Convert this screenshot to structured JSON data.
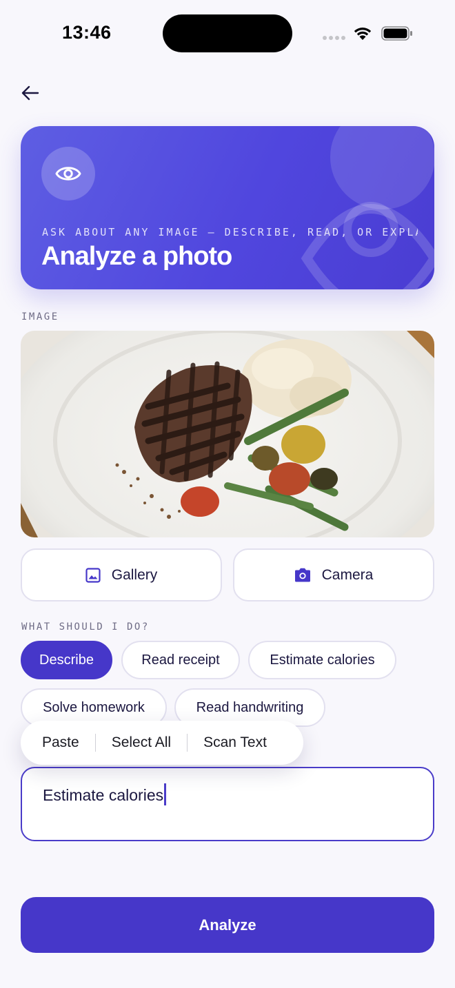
{
  "status_bar": {
    "time": "13:46"
  },
  "hero": {
    "subtitle": "ASK ABOUT ANY IMAGE — DESCRIBE, READ, OR EXPLA…",
    "title": "Analyze a photo",
    "icon": "eye-icon"
  },
  "image_section": {
    "label": "IMAGE"
  },
  "source_buttons": {
    "gallery": {
      "label": "Gallery",
      "icon": "image-icon"
    },
    "camera": {
      "label": "Camera",
      "icon": "camera-icon"
    }
  },
  "actions": {
    "label": "WHAT SHOULD I DO?",
    "chips": [
      {
        "label": "Describe",
        "selected": true
      },
      {
        "label": "Read receipt",
        "selected": false
      },
      {
        "label": "Estimate calories",
        "selected": false
      },
      {
        "label": "Solve homework",
        "selected": false
      },
      {
        "label": "Read handwriting",
        "selected": false
      }
    ]
  },
  "context_menu": {
    "items": [
      "Paste",
      "Select All",
      "Scan Text"
    ]
  },
  "prompt": {
    "value": "Estimate calories"
  },
  "analyze_button": {
    "label": "Analyze"
  },
  "colors": {
    "accent": "#4637c9",
    "hero_start": "#5e5ee3",
    "background": "#f8f7fc"
  }
}
